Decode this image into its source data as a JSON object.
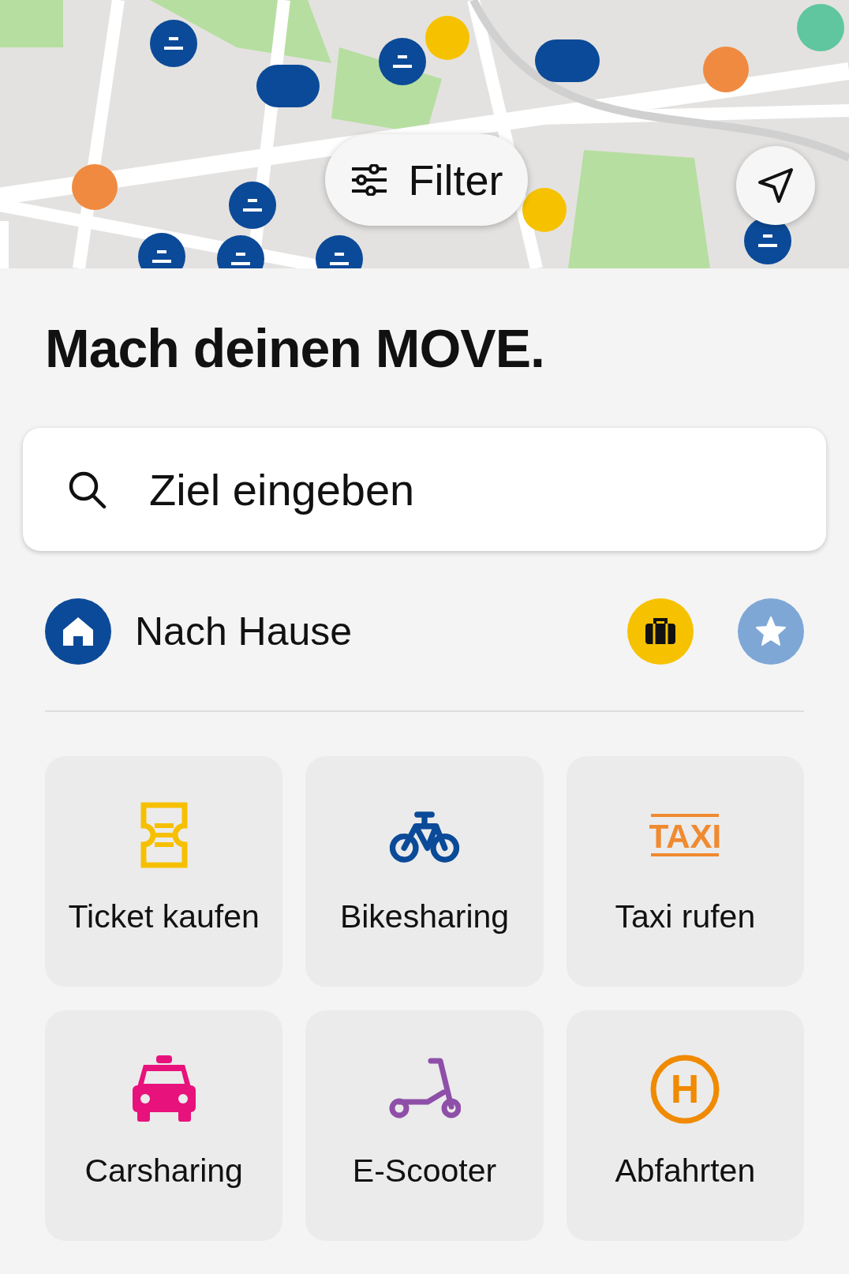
{
  "filter_button": {
    "label": "Filter"
  },
  "title": "Mach deinen MOVE.",
  "search": {
    "placeholder": "Ziel eingeben"
  },
  "home_shortcut": {
    "label": "Nach Hause"
  },
  "tiles": [
    {
      "kind": "ticket",
      "label": "Ticket kaufen"
    },
    {
      "kind": "bike",
      "label": "Bikesharing"
    },
    {
      "kind": "taxi",
      "label": "Taxi rufen",
      "badge": "TAXI"
    },
    {
      "kind": "car",
      "label": "Carsharing"
    },
    {
      "kind": "scooter",
      "label": "E-Scooter"
    },
    {
      "kind": "stop",
      "label": "Abfahrten",
      "badge": "H"
    }
  ]
}
